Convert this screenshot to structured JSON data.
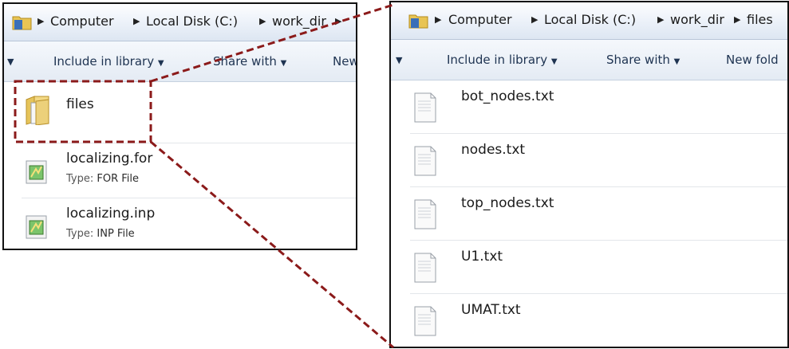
{
  "left_window": {
    "breadcrumb": [
      "Computer",
      "Local Disk (C:)",
      "work_dir"
    ],
    "toolbar": {
      "include_label": "Include in library",
      "share_label": "Share with",
      "new_label": "New"
    },
    "items": [
      {
        "name": "files",
        "type_label": "",
        "type_value": "",
        "icon": "folder-icon"
      },
      {
        "name": "localizing.for",
        "type_label": "Type:",
        "type_value": "FOR File",
        "icon": "script-file-icon"
      },
      {
        "name": "localizing.inp",
        "type_label": "Type:",
        "type_value": "INP File",
        "icon": "script-file-icon"
      }
    ]
  },
  "right_window": {
    "breadcrumb": [
      "Computer",
      "Local Disk (C:)",
      "work_dir",
      "files"
    ],
    "toolbar": {
      "include_label": "Include in library",
      "share_label": "Share with",
      "new_label": "New fold"
    },
    "items": [
      {
        "name": "bot_nodes.txt",
        "icon": "text-file-icon"
      },
      {
        "name": "nodes.txt",
        "icon": "text-file-icon"
      },
      {
        "name": "top_nodes.txt",
        "icon": "text-file-icon"
      },
      {
        "name": "U1.txt",
        "icon": "text-file-icon"
      },
      {
        "name": "UMAT.txt",
        "icon": "text-file-icon"
      }
    ]
  },
  "highlight_color": "#8b1a1a"
}
